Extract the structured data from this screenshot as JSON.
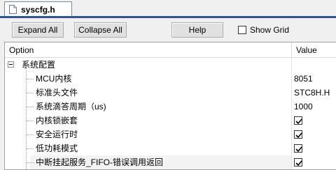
{
  "tab": {
    "filename": "syscfg.h"
  },
  "toolbar": {
    "expand_all": "Expand All",
    "collapse_all": "Collapse All",
    "help": "Help",
    "show_grid": "Show Grid"
  },
  "grid": {
    "columns": {
      "option": "Option",
      "value": "Value"
    },
    "group": {
      "label": "系统配置",
      "expanded": true
    },
    "rows": [
      {
        "name": "MCU内核",
        "value": "8051",
        "type": "text"
      },
      {
        "name": "标准头文件",
        "value": "STC8H.H",
        "type": "text"
      },
      {
        "name": "系统滴答周期（us)",
        "value": "1000",
        "type": "text"
      },
      {
        "name": "内核锁嵌套",
        "value": "checked",
        "type": "checkbox"
      },
      {
        "name": "安全运行时",
        "value": "checked",
        "type": "checkbox"
      },
      {
        "name": "低功耗模式",
        "value": "checked",
        "type": "checkbox"
      },
      {
        "name": "中断挂起服务_FIFO-错误调用返回",
        "value": "checked",
        "type": "checkbox",
        "selected": true
      }
    ]
  },
  "colors": {
    "tab_accent": "#2f5597",
    "grid_bg": "#ffffff",
    "panel_bg": "#f0f0f0"
  },
  "icons": {
    "tab_file": "document-icon",
    "tree_toggle": "collapse-minus-icon",
    "check": "checkmark-icon"
  }
}
